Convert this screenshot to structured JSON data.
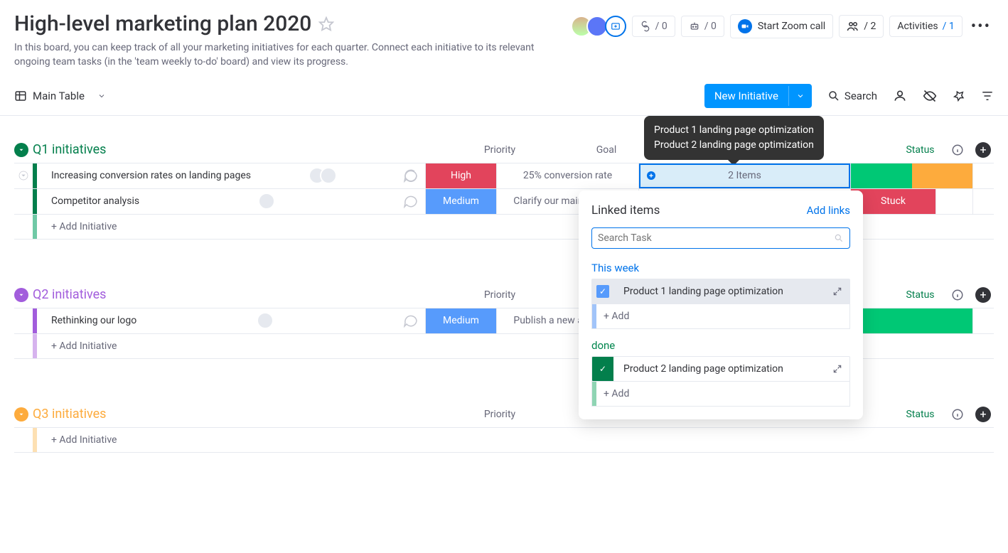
{
  "header": {
    "title": "High-level marketing plan 2020",
    "description": "In this board, you can keep track of all your marketing initiatives for each quarter. Connect each initiative to its relevant ongoing team tasks (in the 'team weekly to-do' board) and view its progress.",
    "counter1": "/ 0",
    "counter2": "/ 0",
    "zoom_label": "Start Zoom call",
    "people_count": "/ 2",
    "activities_label": "Activities",
    "activities_count": "/ 1"
  },
  "toolbar": {
    "view_label": "Main Table",
    "new_button": "New Initiative",
    "search_label": "Search"
  },
  "columns": {
    "priority": "Priority",
    "goal": "Goal",
    "status": "Status"
  },
  "groups": {
    "q1": {
      "title": "Q1 initiatives",
      "rows": [
        {
          "name": "Increasing conversion rates on landing pages",
          "priority": "High",
          "goal": "25% conversion rate",
          "linked_count": "2 Items"
        },
        {
          "name": "Competitor analysis",
          "priority": "Medium",
          "goal": "Clarify our main competi",
          "status": "Stuck"
        }
      ],
      "add": "+ Add Initiative"
    },
    "q2": {
      "title": "Q2 initiatives",
      "rows": [
        {
          "name": "Rethinking our logo",
          "priority": "Medium",
          "goal": "Publish a new and updat"
        }
      ],
      "add": "+ Add Initiative"
    },
    "q3": {
      "title": "Q3 initiatives",
      "add": "+ Add Initiative"
    }
  },
  "tooltip": {
    "line1": "Product 1 landing page optimization",
    "line2": "Product 2 landing page optimization"
  },
  "popup": {
    "title": "Linked items",
    "add_links": "Add links",
    "search_placeholder": "Search Task",
    "section1": "This week",
    "item1": "Product 1 landing page optimization",
    "add1": "+ Add",
    "section2": "done",
    "item2": "Product 2 landing page optimization",
    "add2": "+ Add"
  }
}
